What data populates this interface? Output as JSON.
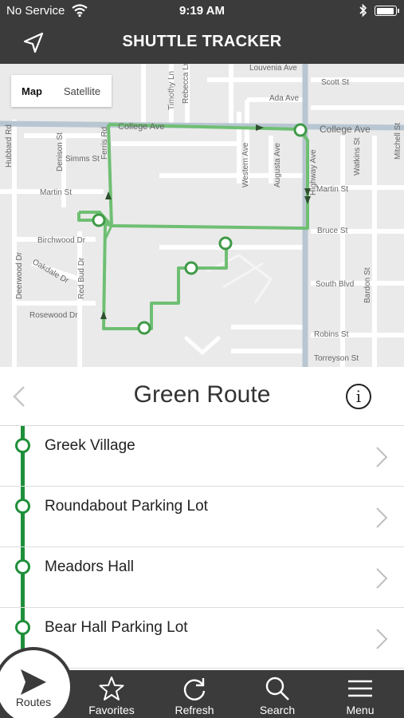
{
  "status_bar": {
    "carrier": "No Service",
    "time": "9:19 AM"
  },
  "header": {
    "title": "SHUTTLE TRACKER"
  },
  "map": {
    "toggle": {
      "map_label": "Map",
      "satellite_label": "Satellite",
      "selected": "Map"
    },
    "streets": [
      "Louvenia Ave",
      "Scott St",
      "Ada Ave",
      "College Ave",
      "College Ave",
      "Timothy Ln",
      "Rebecca Ln",
      "Hubbard Rd",
      "Denison St",
      "Simms St",
      "Ferris Rd",
      "Western Ave",
      "Augusta Ave",
      "Highway Ave",
      "Watkins St",
      "Mitchell St",
      "Martin St",
      "Martin St",
      "Birchwood Dr",
      "Bruce St",
      "Oakdale Dr",
      "Deerwood Dr",
      "Red Bud Dr",
      "South Blvd",
      "Bardon St",
      "Rosewood Dr",
      "Robins St",
      "Torreyson St"
    ],
    "route_color": "#6fbf73"
  },
  "route": {
    "name": "Green Route",
    "color": "#1f8f3a"
  },
  "stops": [
    {
      "label": "Greek Village"
    },
    {
      "label": "Roundabout Parking Lot"
    },
    {
      "label": "Meadors Hall"
    },
    {
      "label": "Bear Hall Parking Lot"
    }
  ],
  "tabs": {
    "routes": "Routes",
    "favorites": "Favorites",
    "refresh": "Refresh",
    "search": "Search",
    "menu": "Menu"
  }
}
